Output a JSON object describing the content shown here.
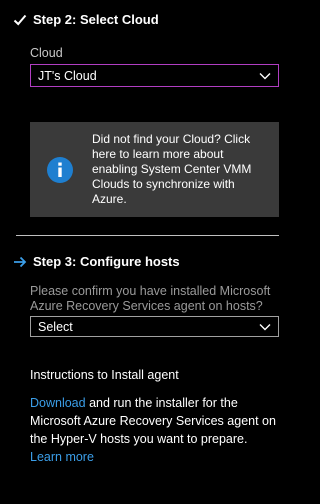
{
  "step2": {
    "title": "Step 2: Select Cloud",
    "cloud_label": "Cloud",
    "cloud_selected": "JT's Cloud",
    "info_text": "Did not find your Cloud? Click here to learn more about enabling System Center VMM Clouds to synchronize with Azure."
  },
  "step3": {
    "title": "Step 3: Configure hosts",
    "confirm_text": "Please confirm you have installed Microsoft Azure Recovery Services agent on hosts?",
    "hosts_selected": "Select"
  },
  "instructions": {
    "heading": "Instructions to Install agent",
    "download_link": "Download",
    "body_text": " and run the installer for the Microsoft Azure Recovery Services agent on the Hyper-V hosts you want to prepare. ",
    "learn_more_link": "Learn more"
  },
  "colors": {
    "background": "#000000",
    "focus_border": "#b13ec2",
    "info_box": "#3a3a3a",
    "info_icon": "#1e7fd0",
    "link": "#3b9ee8"
  },
  "icons": {
    "step2": "checkmark-icon",
    "step3": "arrow-right-icon",
    "info": "info-icon",
    "dropdown": "chevron-down-icon"
  }
}
